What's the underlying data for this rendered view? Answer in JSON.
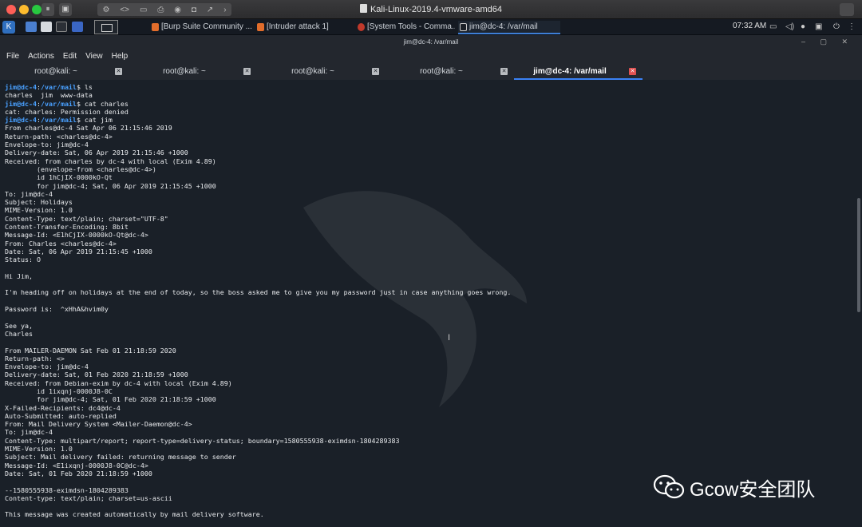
{
  "vm": {
    "title": "Kali-Linux-2019.4-vmware-amd64"
  },
  "panel": {
    "tasks": [
      {
        "label": "[Burp Suite Community ...",
        "color": "#e26d2b"
      },
      {
        "label": "[Intruder attack 1]",
        "color": "#e26d2b"
      },
      {
        "label": "[System Tools - Comma...",
        "color": "#c0392b"
      },
      {
        "label": "jim@dc-4: /var/mail",
        "color": "#cccccc"
      }
    ],
    "clock": "07:32 AM"
  },
  "terminal": {
    "window_title": "jim@dc-4: /var/mail",
    "menu": [
      "File",
      "Actions",
      "Edit",
      "View",
      "Help"
    ],
    "tabs": [
      {
        "label": "root@kali: ~"
      },
      {
        "label": "root@kali: ~"
      },
      {
        "label": "root@kali: ~"
      },
      {
        "label": "root@kali: ~"
      },
      {
        "label": "jim@dc-4: /var/mail"
      }
    ],
    "prompt_user": "jim@dc-4",
    "prompt_path": "/var/mail",
    "lines": [
      {
        "type": "prompt",
        "cmd": "ls"
      },
      {
        "type": "out",
        "text": "charles  jim  www-data"
      },
      {
        "type": "prompt",
        "cmd": "cat charles"
      },
      {
        "type": "out",
        "text": "cat: charles: Permission denied"
      },
      {
        "type": "prompt",
        "cmd": "cat jim"
      },
      {
        "type": "out",
        "text": "From charles@dc-4 Sat Apr 06 21:15:46 2019"
      },
      {
        "type": "out",
        "text": "Return-path: <charles@dc-4>"
      },
      {
        "type": "out",
        "text": "Envelope-to: jim@dc-4"
      },
      {
        "type": "out",
        "text": "Delivery-date: Sat, 06 Apr 2019 21:15:46 +1000"
      },
      {
        "type": "out",
        "text": "Received: from charles by dc-4 with local (Exim 4.89)"
      },
      {
        "type": "out",
        "text": "        (envelope-from <charles@dc-4>)"
      },
      {
        "type": "out",
        "text": "        id 1hCjIX-0000kO-Qt"
      },
      {
        "type": "out",
        "text": "        for jim@dc-4; Sat, 06 Apr 2019 21:15:45 +1000"
      },
      {
        "type": "out",
        "text": "To: jim@dc-4"
      },
      {
        "type": "out",
        "text": "Subject: Holidays"
      },
      {
        "type": "out",
        "text": "MIME-Version: 1.0"
      },
      {
        "type": "out",
        "text": "Content-Type: text/plain; charset=\"UTF-8\""
      },
      {
        "type": "out",
        "text": "Content-Transfer-Encoding: 8bit"
      },
      {
        "type": "out",
        "text": "Message-Id: <E1hCjIX-0000kO-Qt@dc-4>"
      },
      {
        "type": "out",
        "text": "From: Charles <charles@dc-4>"
      },
      {
        "type": "out",
        "text": "Date: Sat, 06 Apr 2019 21:15:45 +1000"
      },
      {
        "type": "out",
        "text": "Status: O"
      },
      {
        "type": "out",
        "text": ""
      },
      {
        "type": "out",
        "text": "Hi Jim,"
      },
      {
        "type": "out",
        "text": ""
      },
      {
        "type": "out",
        "text": "I'm heading off on holidays at the end of today, so the boss asked me to give you my password just in case anything goes wrong."
      },
      {
        "type": "out",
        "text": ""
      },
      {
        "type": "out",
        "text": "Password is:  ^xHhA&hvim0y"
      },
      {
        "type": "out",
        "text": ""
      },
      {
        "type": "out",
        "text": "See ya,"
      },
      {
        "type": "out",
        "text": "Charles"
      },
      {
        "type": "out",
        "text": ""
      },
      {
        "type": "out",
        "text": "From MAILER-DAEMON Sat Feb 01 21:18:59 2020"
      },
      {
        "type": "out",
        "text": "Return-path: <>"
      },
      {
        "type": "out",
        "text": "Envelope-to: jim@dc-4"
      },
      {
        "type": "out",
        "text": "Delivery-date: Sat, 01 Feb 2020 21:18:59 +1000"
      },
      {
        "type": "out",
        "text": "Received: from Debian-exim by dc-4 with local (Exim 4.89)"
      },
      {
        "type": "out",
        "text": "        id 1ixqnj-0000J8-0C"
      },
      {
        "type": "out",
        "text": "        for jim@dc-4; Sat, 01 Feb 2020 21:18:59 +1000"
      },
      {
        "type": "out",
        "text": "X-Failed-Recipients: dc4@dc-4"
      },
      {
        "type": "out",
        "text": "Auto-Submitted: auto-replied"
      },
      {
        "type": "out",
        "text": "From: Mail Delivery System <Mailer-Daemon@dc-4>"
      },
      {
        "type": "out",
        "text": "To: jim@dc-4"
      },
      {
        "type": "out",
        "text": "Content-Type: multipart/report; report-type=delivery-status; boundary=1580555938-eximdsn-1804289383"
      },
      {
        "type": "out",
        "text": "MIME-Version: 1.0"
      },
      {
        "type": "out",
        "text": "Subject: Mail delivery failed: returning message to sender"
      },
      {
        "type": "out",
        "text": "Message-Id: <E1ixqnj-0000J8-0C@dc-4>"
      },
      {
        "type": "out",
        "text": "Date: Sat, 01 Feb 2020 21:18:59 +1000"
      },
      {
        "type": "out",
        "text": ""
      },
      {
        "type": "out",
        "text": "--1580555938-eximdsn-1804289383"
      },
      {
        "type": "out",
        "text": "Content-type: text/plain; charset=us-ascii"
      },
      {
        "type": "out",
        "text": ""
      },
      {
        "type": "out",
        "text": "This message was created automatically by mail delivery software."
      }
    ]
  },
  "watermark": {
    "text": "Gcow安全团队"
  }
}
